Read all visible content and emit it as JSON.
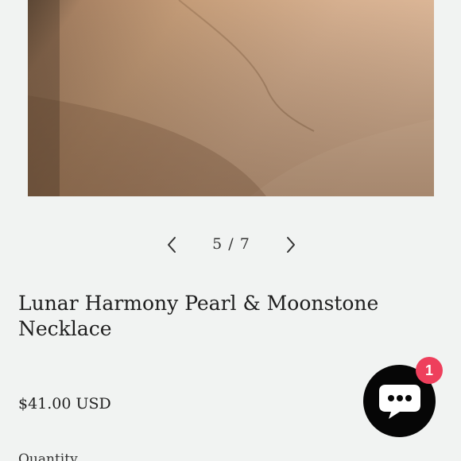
{
  "gallery": {
    "image_alt": "Product photo",
    "counter": "5 / 7",
    "prev_icon": "chevron-left-icon",
    "next_icon": "chevron-right-icon"
  },
  "product": {
    "title": "Lunar Harmony Pearl & Moonstone Necklace",
    "price": "$41.00 USD",
    "quantity_label": "Quantity"
  },
  "chat": {
    "icon": "chat-bubble-icon",
    "badge_count": "1",
    "colors": {
      "button": "#060606",
      "badge": "#ee3f5c"
    }
  },
  "colors": {
    "background": "#f1f3f2",
    "text": "#1f1f1f"
  }
}
